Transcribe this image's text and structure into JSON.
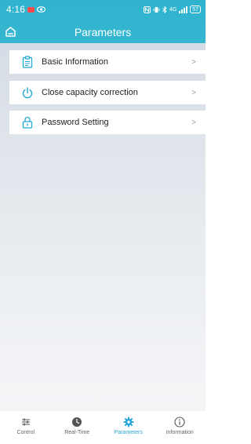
{
  "status_bar": {
    "time": "4:16",
    "network": "4G",
    "battery": "57"
  },
  "header": {
    "title": "Parameters"
  },
  "menu": {
    "items": [
      {
        "label": "Basic Information",
        "icon": "clipboard-icon"
      },
      {
        "label": "Close capacity correction",
        "icon": "power-icon"
      },
      {
        "label": "Password Setting",
        "icon": "lock-icon"
      }
    ],
    "arrow": ">"
  },
  "tabbar": {
    "tabs": [
      {
        "label": "Control",
        "icon": "sliders-icon",
        "active": false
      },
      {
        "label": "Real-Time",
        "icon": "clock-icon",
        "active": false
      },
      {
        "label": "Parameters",
        "icon": "gear-icon",
        "active": true
      },
      {
        "label": "Information",
        "icon": "info-icon",
        "active": false
      }
    ]
  },
  "colors": {
    "header": "#2fb3cf",
    "accent": "#2aa7d8",
    "icon": "#21a9d6",
    "background": "#dfe4ea"
  }
}
